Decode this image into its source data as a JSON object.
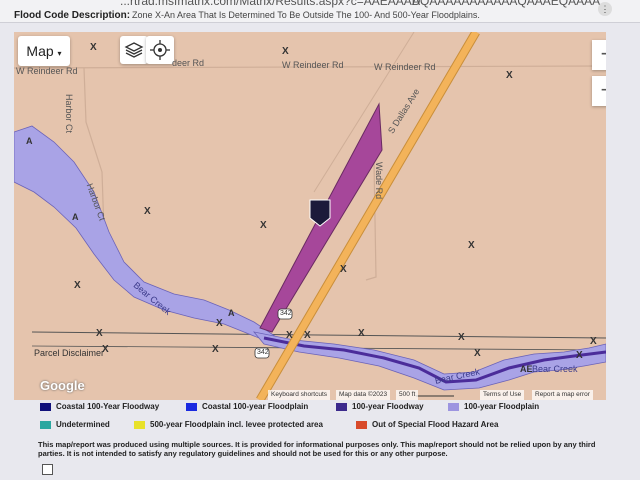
{
  "browser": {
    "url_fragment": "...rtrad.msfmatrix.com/Matrix/Results.aspx?c=AAEAAAD",
    "url_tail": "AQAAAAAAAAAAAQAAAEQAAAA...",
    "heading_label": "Flood Code Description:",
    "heading_text": "Zone X-An Area That Is Determined To Be Outside The 100- And 500-Year Floodplains."
  },
  "map": {
    "map_type_label": "Map",
    "zoom_in_label": "+",
    "zoom_out_label": "−",
    "road_labels": {
      "reindeer_left": "W Reindeer Rd",
      "reindeer_mid1": "W Reindeer Rd",
      "reindeer_mid2": "W Reindeer Rd",
      "reindeer_right": "W Reindeer Rd",
      "harbor_ct_1": "Harbor Ct",
      "harbor_ct_2": "Harbor Ct",
      "s_dallas_ave": "S Dallas Ave",
      "wade_rd": "Wade Rd",
      "bear_creek_1": "Bear Creek",
      "bear_creek_2": "Bear Creek",
      "bear_creek_3": "Bear Creek",
      "parcel_disclaimer": "Parcel Disclaimer",
      "route_342": "342"
    },
    "zone_marks": {
      "x": "X",
      "a": "A",
      "ae": "AE"
    },
    "google_label": "Google",
    "attribution": {
      "keyboard": "Keyboard shortcuts",
      "data": "Map data ©2023",
      "scale": "500 ft",
      "terms": "Terms of Use",
      "report": "Report a map error"
    },
    "colors": {
      "base": "#e5c4ad",
      "floodplain_100": "#a9a3e6",
      "floodway_100": "#4b2c9a",
      "subject_parcel": "#a6479a",
      "highway": "#f3b35a"
    }
  },
  "legend": [
    {
      "label": "Coastal 100-Year Floodway",
      "color": "#10107a"
    },
    {
      "label": "Coastal 100-year Floodplain",
      "color": "#1a2ae0"
    },
    {
      "label": "100-year Floodway",
      "color": "#3c2a8c"
    },
    {
      "label": "100-year Floodplain",
      "color": "#9d95e0"
    },
    {
      "label": "Undetermined",
      "color": "#2aa7a0"
    },
    {
      "label": "500-year Floodplain incl. levee protected area",
      "color": "#e8e12a"
    },
    {
      "label": "Out of Special Flood Hazard Area",
      "color": "#d84a2a"
    }
  ],
  "disclaimer": "This map/report was produced using multiple sources. It is provided for informational purposes only. This map/report should not be relied upon by any third parties. It is not intended to satisfy any regulatory guidelines and should not be used for this or any other purpose."
}
